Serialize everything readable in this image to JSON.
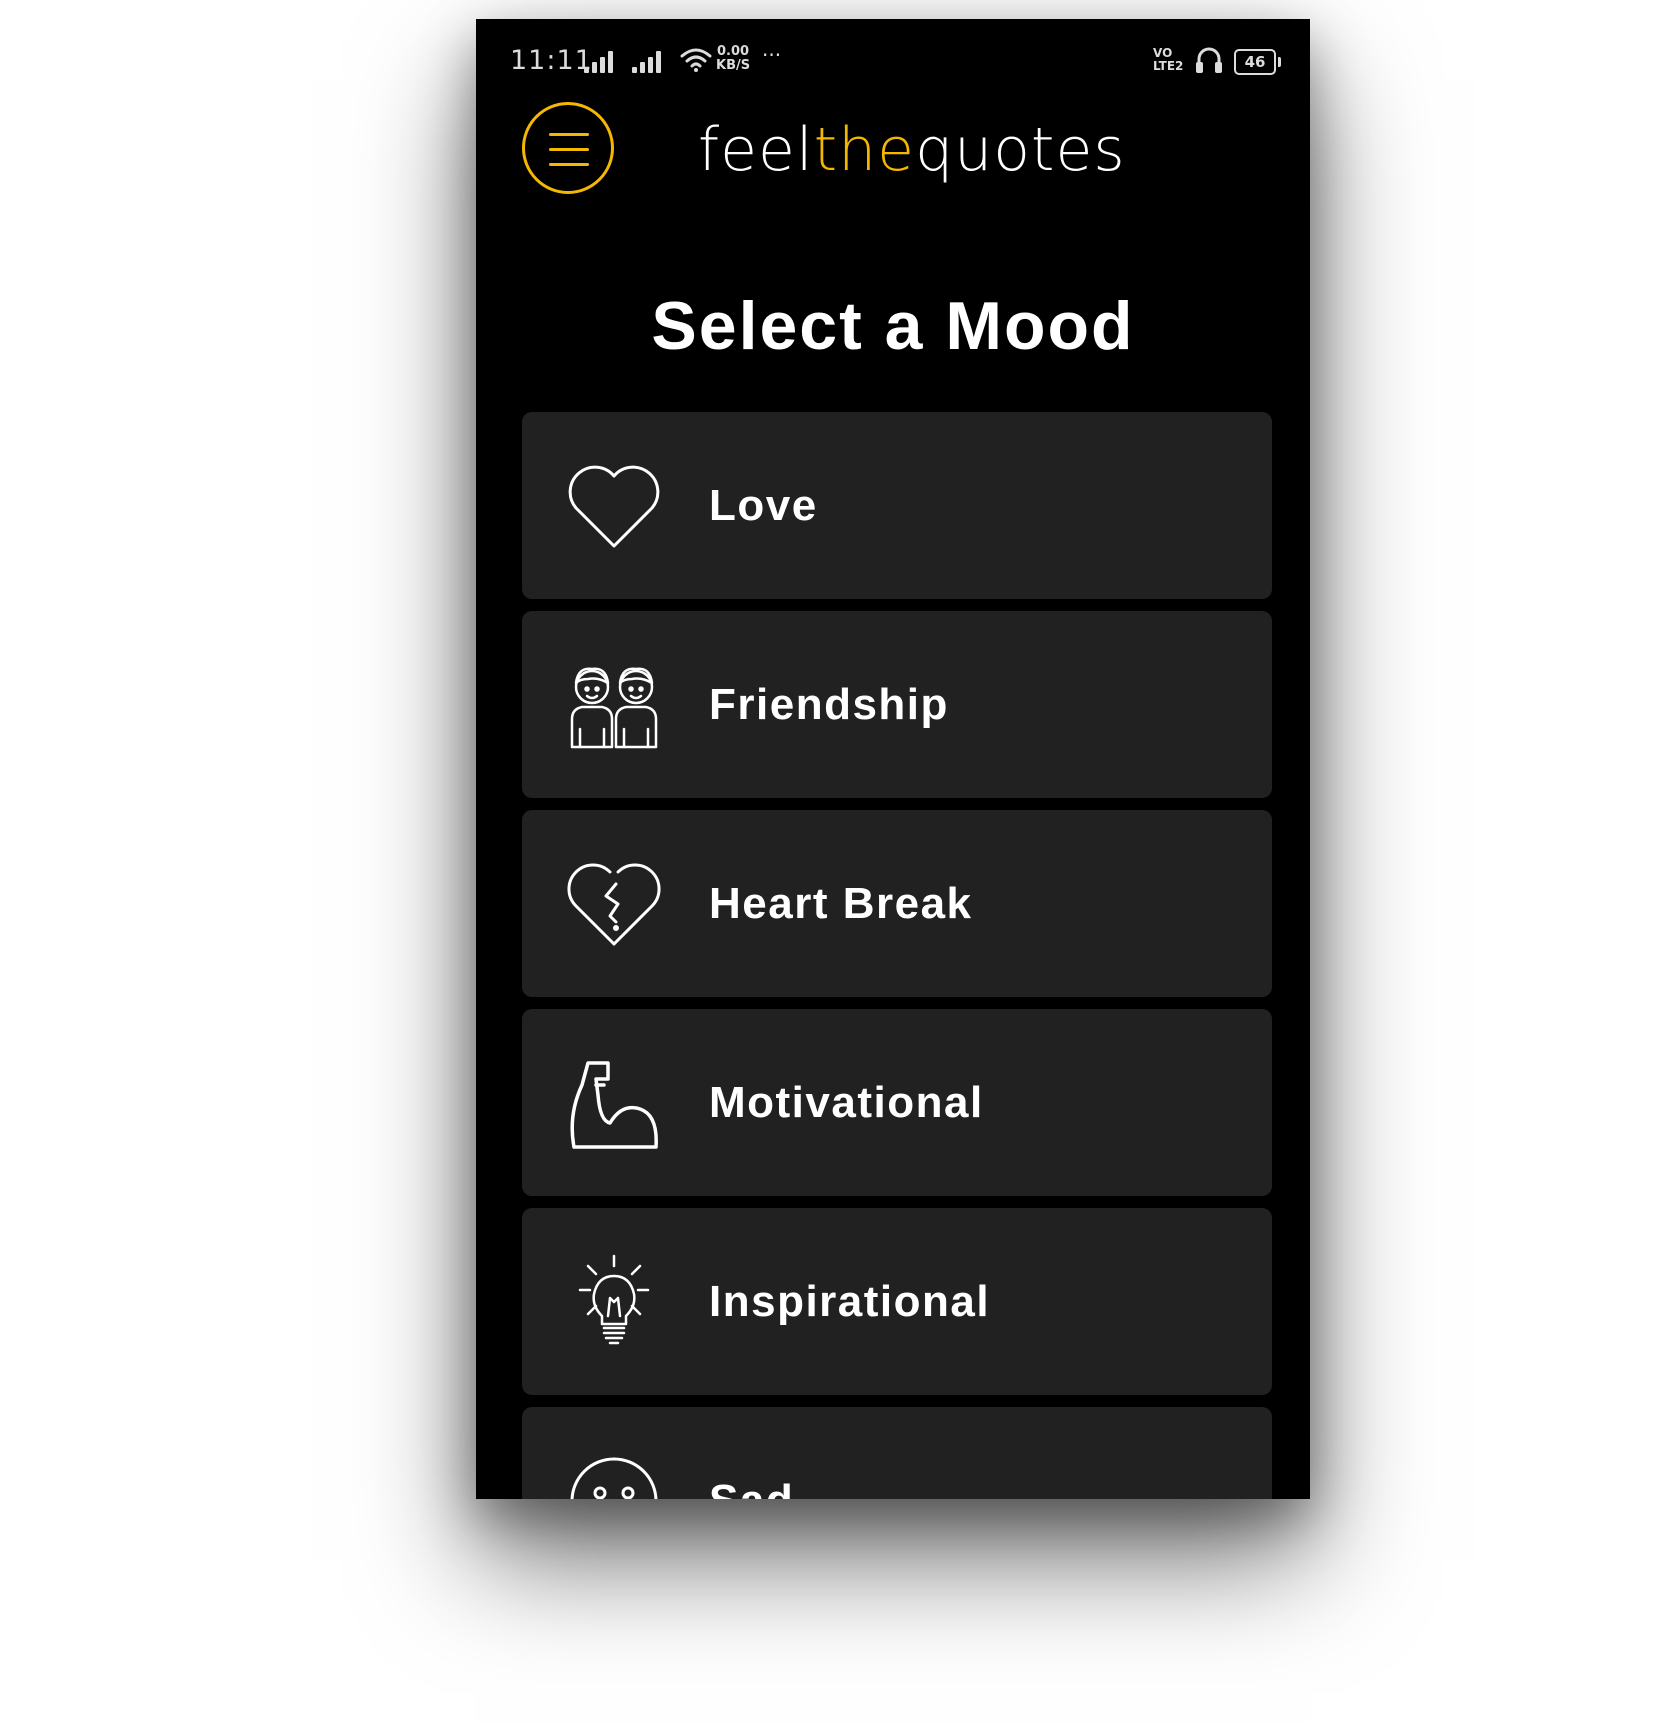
{
  "status_bar": {
    "time": "11:11",
    "speed_value": "0.00",
    "speed_unit": "KB/S",
    "more": "···",
    "volte_top": "VO",
    "volte_bottom": "LTE2",
    "battery": "46"
  },
  "header": {
    "logo_part1": "feel",
    "logo_part2": "the",
    "logo_part3": "quotes"
  },
  "page": {
    "title": "Select a Mood"
  },
  "moods": [
    {
      "label": "Love",
      "icon": "heart-icon"
    },
    {
      "label": "Friendship",
      "icon": "friends-icon"
    },
    {
      "label": "Heart Break",
      "icon": "broken-heart-icon"
    },
    {
      "label": "Motivational",
      "icon": "flexed-arm-icon"
    },
    {
      "label": "Inspirational",
      "icon": "lightbulb-icon"
    },
    {
      "label": "Sad",
      "icon": "sad-face-icon"
    }
  ],
  "colors": {
    "background": "#000000",
    "card": "#212121",
    "accent": "#f5b800",
    "text": "#ffffff"
  }
}
